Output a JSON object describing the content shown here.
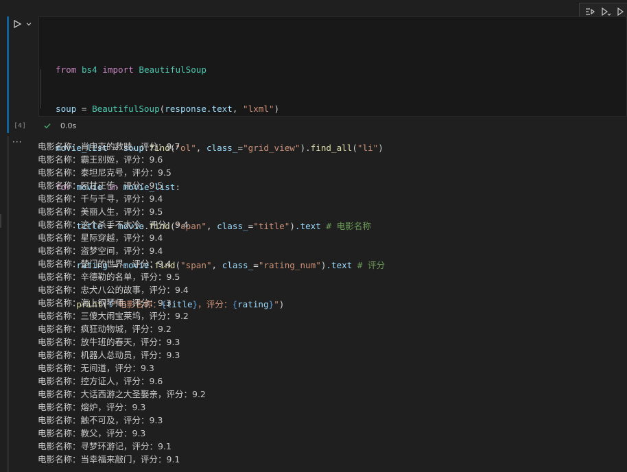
{
  "cell": {
    "execution_count": "[4]",
    "exec_time": "0.0s",
    "code": {
      "line1": {
        "kw_from": "from",
        "module": "bs4",
        "kw_import": "import",
        "cls": "BeautifulSoup"
      },
      "line2": {
        "var": "soup",
        "eq": " = ",
        "cls": "BeautifulSoup",
        "open": "(",
        "arg": "response.text",
        "comma": ", ",
        "str": "\"lxml\"",
        "close": ")"
      },
      "line3": {
        "var": "movie_list",
        "eq": " = ",
        "obj": "soup",
        "dot1": ".",
        "fn1": "find",
        "open1": "(",
        "str1": "\"ol\"",
        "comma": ", ",
        "kwarg": "class_",
        "eq2": "=",
        "str2": "\"grid_view\"",
        "close1": ")",
        "dot2": ".",
        "fn2": "find_all",
        "open2": "(",
        "str3": "\"li\"",
        "close2": ")"
      },
      "line4": {
        "kw_for": "for",
        "var1": "movie",
        "kw_in": "in",
        "var2": "movie_list",
        "colon": ":"
      },
      "line5": {
        "var": "title",
        "eq": " = ",
        "obj": "movie",
        "dot": ".",
        "fn": "find",
        "open": "(",
        "str1": "\"span\"",
        "comma": ", ",
        "kwarg": "class_",
        "eq2": "=",
        "str2": "\"title\"",
        "close": ")",
        "attr": ".text",
        "comment": "# 电影名称"
      },
      "line6": {
        "var": "rating",
        "eq": " = ",
        "obj": "movie",
        "dot": ".",
        "fn": "find",
        "open": "(",
        "str1": "\"span\"",
        "comma": ", ",
        "kwarg": "class_",
        "eq2": "=",
        "str2": "\"rating_num\"",
        "close": ")",
        "attr": ".text",
        "comment": "# 评分"
      },
      "line7": {
        "fn": "print",
        "open": "(",
        "prefix": "f",
        "str1": "\"电影名称：",
        "b1o": "{",
        "v1": "title",
        "b1c": "}",
        "str2": "，评分：",
        "b2o": "{",
        "v2": "rating",
        "b2c": "}",
        "str3": "\"",
        "close": ")"
      }
    }
  },
  "output": {
    "menu": "···",
    "lines": [
      "电影名称：肖申克的救赎，评分：9.7",
      "电影名称：霸王别姬，评分：9.6",
      "电影名称：泰坦尼克号，评分：9.5",
      "电影名称：阿甘正传，评分：9.5",
      "电影名称：千与千寻，评分：9.4",
      "电影名称：美丽人生，评分：9.5",
      "电影名称：这个杀手不太冷，评分：9.4",
      "电影名称：星际穿越，评分：9.4",
      "电影名称：盗梦空间，评分：9.4",
      "电影名称：楚门的世界，评分：9.4",
      "电影名称：辛德勒的名单，评分：9.5",
      "电影名称：忠犬八公的故事，评分：9.4",
      "电影名称：海上钢琴师，评分：9.3",
      "电影名称：三傻大闹宝莱坞，评分：9.2",
      "电影名称：疯狂动物城，评分：9.2",
      "电影名称：放牛班的春天，评分：9.3",
      "电影名称：机器人总动员，评分：9.3",
      "电影名称：无间道，评分：9.3",
      "电影名称：控方证人，评分：9.6",
      "电影名称：大话西游之大圣娶亲，评分：9.2",
      "电影名称：熔炉，评分：9.3",
      "电影名称：触不可及，评分：9.3",
      "电影名称：教父，评分：9.3",
      "电影名称：寻梦环游记，评分：9.1",
      "电影名称：当幸福来敲门，评分：9.1"
    ]
  },
  "icons": {
    "toolbar": [
      "execute-above-icon",
      "execute-below-icon",
      "split-cell-icon"
    ],
    "run": "run-cell-icon",
    "chevron": "chevron-down-icon",
    "success": "check-icon"
  },
  "colors": {
    "accent": "#0e639c",
    "success": "#4aa56b",
    "background": "#1f1f1f"
  }
}
